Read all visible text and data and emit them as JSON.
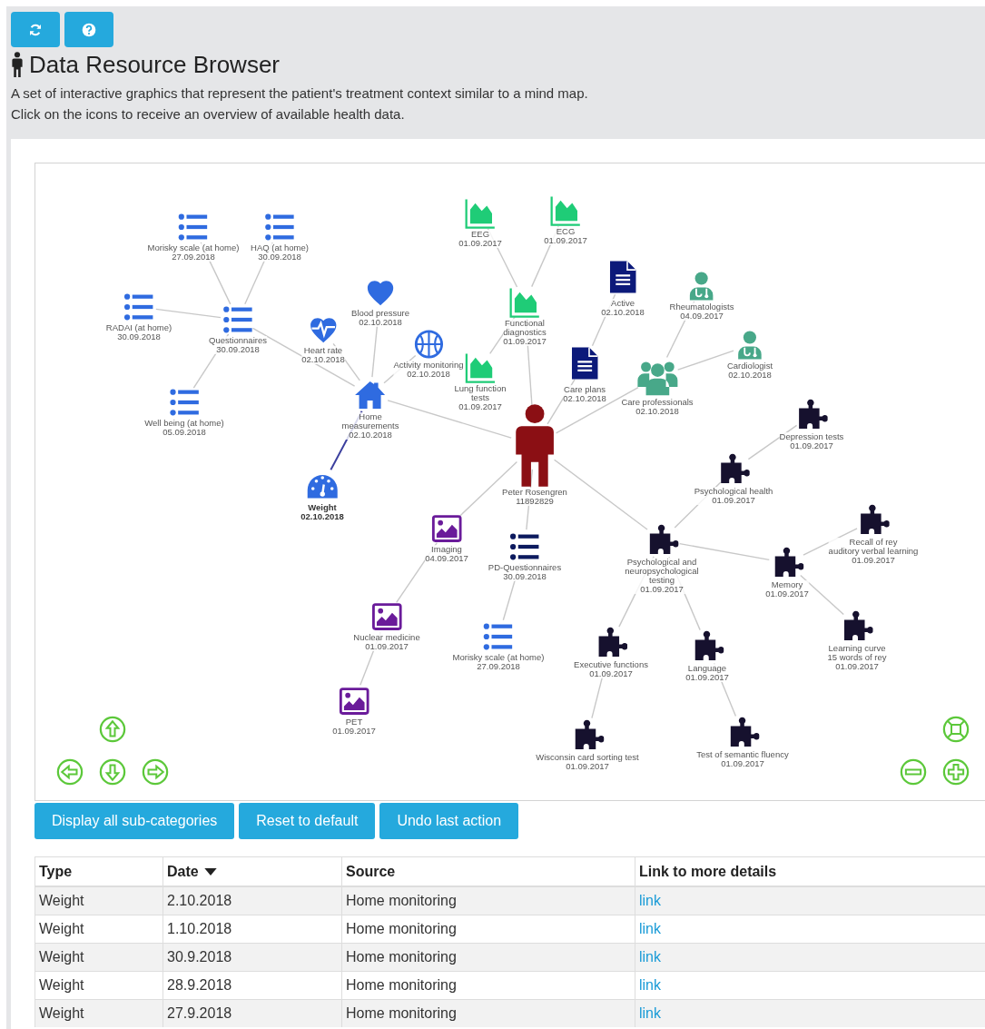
{
  "toolbar": {
    "buttons": [
      {
        "kind": "refresh"
      },
      {
        "kind": "help"
      }
    ]
  },
  "title": "Data Resource Browser",
  "description": [
    "A set of interactive graphics that represent the patient's treatment context similar to a mind map.",
    "Click on the icons to receive an overview of available health data."
  ],
  "graph": {
    "root": {
      "kind": "patient",
      "color": "#8b0f14",
      "selected": false,
      "lines": [
        "Peter Rosengren"
      ],
      "date": "11892829",
      "children": [
        {
          "kind": "home",
          "color": "#2f6be0",
          "selected": false,
          "lines": [
            "Home",
            "measurements"
          ],
          "date": "02.10.2018",
          "children": [
            {
              "kind": "questionnaire",
              "color": "#2f6be0",
              "selected": false,
              "lines": [
                "Questionnaires"
              ],
              "date": "30.09.2018",
              "children": [
                {
                  "kind": "questionnaire",
                  "color": "#2f6be0",
                  "selected": false,
                  "lines": [
                    "Morisky scale (at home)"
                  ],
                  "date": "27.09.2018"
                },
                {
                  "kind": "questionnaire",
                  "color": "#2f6be0",
                  "selected": false,
                  "lines": [
                    "HAQ (at home)"
                  ],
                  "date": "30.09.2018"
                },
                {
                  "kind": "questionnaire",
                  "color": "#2f6be0",
                  "selected": false,
                  "lines": [
                    "RADAI (at home)"
                  ],
                  "date": "30.09.2018"
                },
                {
                  "kind": "questionnaire",
                  "color": "#2f6be0",
                  "selected": false,
                  "lines": [
                    "Well being (at home)"
                  ],
                  "date": "05.09.2018"
                }
              ]
            },
            {
              "kind": "heart-rate",
              "color": "#2f6be0",
              "selected": false,
              "lines": [
                "Heart rate"
              ],
              "date": "02.10.2018"
            },
            {
              "kind": "blood-pressure",
              "color": "#2f6be0",
              "selected": false,
              "lines": [
                "Blood pressure"
              ],
              "date": "02.10.2018"
            },
            {
              "kind": "activity",
              "color": "#2f6be0",
              "selected": false,
              "lines": [
                "Activity monitoring"
              ],
              "date": "02.10.2018"
            },
            {
              "kind": "weight",
              "color": "#2f6be0",
              "selected": true,
              "lines": [
                "Weight"
              ],
              "date": "02.10.2018"
            }
          ]
        },
        {
          "kind": "diagnostics",
          "color": "#1fcc77",
          "selected": false,
          "lines": [
            "Functional",
            "diagnostics"
          ],
          "date": "01.09.2017",
          "children": [
            {
              "kind": "diagnostics",
              "color": "#1fcc77",
              "selected": false,
              "lines": [
                "EEG"
              ],
              "date": "01.09.2017"
            },
            {
              "kind": "diagnostics",
              "color": "#1fcc77",
              "selected": false,
              "lines": [
                "ECG"
              ],
              "date": "01.09.2017"
            },
            {
              "kind": "diagnostics",
              "color": "#1fcc77",
              "selected": false,
              "lines": [
                "Lung function",
                "tests"
              ],
              "date": "01.09.2017"
            }
          ]
        },
        {
          "kind": "care-plan",
          "color": "#0c1a7a",
          "selected": false,
          "lines": [
            "Care plans"
          ],
          "date": "02.10.2018",
          "children": [
            {
              "kind": "care-plan",
              "color": "#0c1a7a",
              "selected": false,
              "lines": [
                "Active"
              ],
              "date": "02.10.2018"
            }
          ]
        },
        {
          "kind": "team",
          "color": "#48a889",
          "selected": false,
          "lines": [
            "Care professionals"
          ],
          "date": "02.10.2018",
          "children": [
            {
              "kind": "professional",
              "color": "#48a889",
              "selected": false,
              "lines": [
                "Rheumatologists"
              ],
              "date": "04.09.2017"
            },
            {
              "kind": "professional",
              "color": "#48a889",
              "selected": false,
              "lines": [
                "Cardiologist"
              ],
              "date": "02.10.2018"
            }
          ]
        },
        {
          "kind": "test",
          "color": "#16112e",
          "selected": false,
          "lines": [
            "Psychological and",
            "neuropsychological",
            "testing"
          ],
          "date": "01.09.2017",
          "children": [
            {
              "kind": "test",
              "color": "#16112e",
              "selected": false,
              "lines": [
                "Psychological health"
              ],
              "date": "01.09.2017",
              "children": [
                {
                  "kind": "test",
                  "color": "#16112e",
                  "selected": false,
                  "lines": [
                    "Depression tests"
                  ],
                  "date": "01.09.2017"
                }
              ]
            },
            {
              "kind": "test",
              "color": "#16112e",
              "selected": false,
              "lines": [
                "Memory"
              ],
              "date": "01.09.2017",
              "children": [
                {
                  "kind": "test",
                  "color": "#16112e",
                  "selected": false,
                  "lines": [
                    "Recall of rey",
                    "auditory verbal learning"
                  ],
                  "date": "01.09.2017"
                },
                {
                  "kind": "test",
                  "color": "#16112e",
                  "selected": false,
                  "lines": [
                    "Learning curve",
                    "15 words of rey"
                  ],
                  "date": "01.09.2017"
                }
              ]
            },
            {
              "kind": "test",
              "color": "#16112e",
              "selected": false,
              "lines": [
                "Executive functions"
              ],
              "date": "01.09.2017",
              "children": [
                {
                  "kind": "test",
                  "color": "#16112e",
                  "selected": false,
                  "lines": [
                    "Wisconsin card sorting test"
                  ],
                  "date": "01.09.2017"
                }
              ]
            },
            {
              "kind": "test",
              "color": "#16112e",
              "selected": false,
              "lines": [
                "Language"
              ],
              "date": "01.09.2017",
              "children": [
                {
                  "kind": "test",
                  "color": "#16112e",
                  "selected": false,
                  "lines": [
                    "Test of semantic fluency"
                  ],
                  "date": "01.09.2017"
                }
              ]
            }
          ]
        },
        {
          "kind": "imaging",
          "color": "#6a1b9a",
          "selected": false,
          "lines": [
            "Imaging"
          ],
          "date": "04.09.2017",
          "children": [
            {
              "kind": "imaging",
              "color": "#6a1b9a",
              "selected": false,
              "lines": [
                "Nuclear medicine"
              ],
              "date": "01.09.2017",
              "children": [
                {
                  "kind": "imaging",
                  "color": "#6a1b9a",
                  "selected": false,
                  "lines": [
                    "PET"
                  ],
                  "date": "01.09.2017"
                }
              ]
            }
          ]
        },
        {
          "kind": "questionnaire",
          "color": "#0c1a5e",
          "selected": false,
          "lines": [
            "PD-Questionnaires"
          ],
          "date": "30.09.2018",
          "children": [
            {
              "kind": "questionnaire",
              "color": "#2f6be0",
              "selected": false,
              "lines": [
                "Morisky scale (at home)"
              ],
              "date": "27.09.2018"
            }
          ]
        }
      ]
    }
  },
  "actions": [
    "Display all sub-categories",
    "Reset to default",
    "Undo last action"
  ],
  "table": {
    "columns": [
      {
        "label": "Type",
        "sorted": false
      },
      {
        "label": "Date",
        "sorted": true
      },
      {
        "label": "Source",
        "sorted": false
      },
      {
        "label": "Link to more details",
        "sorted": false
      }
    ],
    "rows": [
      [
        "Weight",
        "2.10.2018",
        "Home monitoring",
        "link"
      ],
      [
        "Weight",
        "1.10.2018",
        "Home monitoring",
        "link"
      ],
      [
        "Weight",
        "30.9.2018",
        "Home monitoring",
        "link"
      ],
      [
        "Weight",
        "28.9.2018",
        "Home monitoring",
        "link"
      ],
      [
        "Weight",
        "27.9.2018",
        "Home monitoring",
        "link"
      ]
    ]
  }
}
